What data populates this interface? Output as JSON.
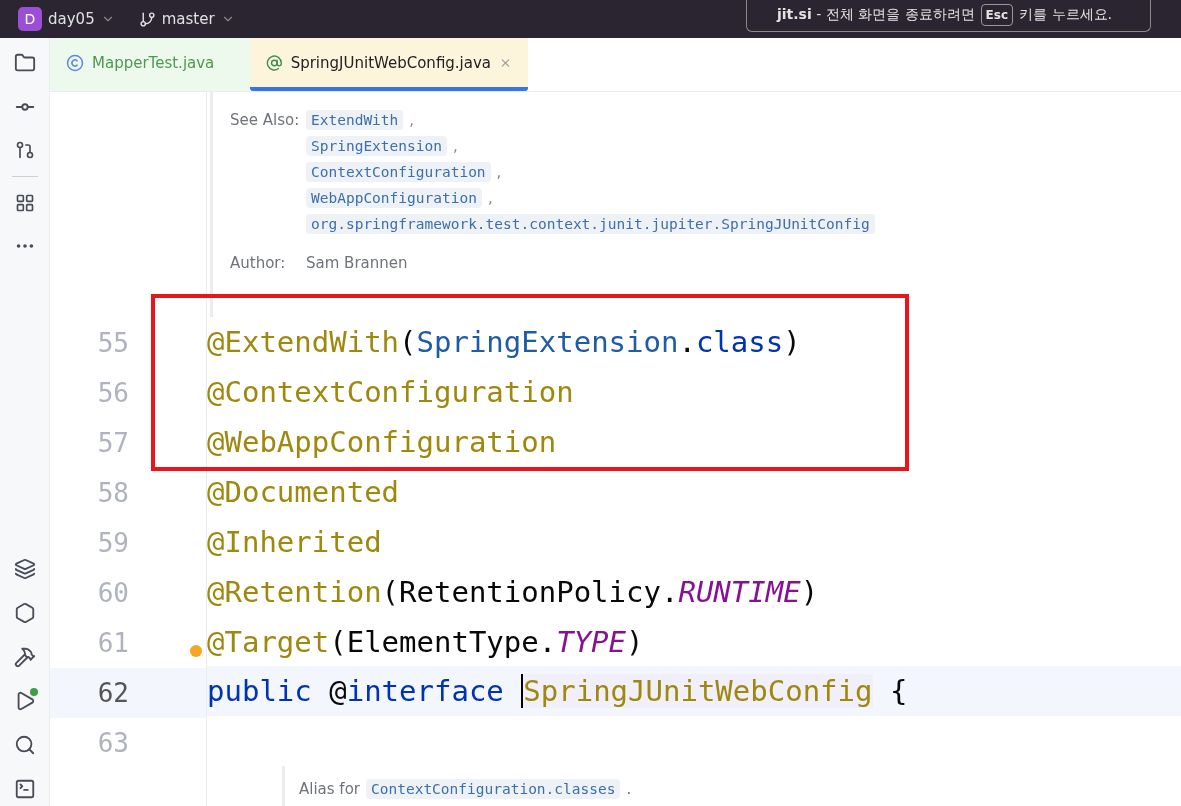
{
  "top_bar": {
    "project_initial": "D",
    "project": "day05",
    "branch": "master"
  },
  "notice": {
    "text": "**jit.si** - 전체 화면을 종료하려면",
    "key": "Esc",
    "after": "키를 누르세요."
  },
  "tabs": [
    {
      "label": "MapperTest.java",
      "kind": "class",
      "selected": false,
      "closable": false
    },
    {
      "label": "SpringJUnitWebConfig.java",
      "kind": "annotation",
      "selected": true,
      "closable": true
    }
  ],
  "doc_top": {
    "see_also_label": "See Also:",
    "see_also": [
      {
        "ref": "ExtendWith",
        "sep": ","
      },
      {
        "ref": "SpringExtension",
        "sep": ","
      },
      {
        "ref": "ContextConfiguration",
        "sep": ","
      },
      {
        "ref": "WebAppConfiguration",
        "sep": ","
      },
      {
        "ref": "org.springframework.test.context.junit.jupiter.SpringJUnitConfig"
      }
    ],
    "author_label": "Author:",
    "author": "Sam Brannen"
  },
  "code_lines": [
    {
      "number": "55",
      "boxed": true,
      "current": false,
      "bulb": false,
      "tokens": [
        {
          "kind": "ann",
          "text": "@ExtendWith"
        },
        {
          "kind": "plain",
          "text": "("
        },
        {
          "kind": "cls",
          "text": "SpringExtension"
        },
        {
          "kind": "plain",
          "text": "."
        },
        {
          "kind": "kw",
          "text": "class"
        },
        {
          "kind": "plain",
          "text": ")"
        }
      ]
    },
    {
      "number": "56",
      "boxed": true,
      "current": false,
      "bulb": false,
      "tokens": [
        {
          "kind": "ann",
          "text": "@ContextConfiguration"
        }
      ]
    },
    {
      "number": "57",
      "boxed": true,
      "current": false,
      "bulb": false,
      "tokens": [
        {
          "kind": "ann",
          "text": "@WebAppConfiguration"
        }
      ]
    },
    {
      "number": "58",
      "boxed": false,
      "current": false,
      "bulb": false,
      "tokens": [
        {
          "kind": "ann",
          "text": "@Documented"
        }
      ]
    },
    {
      "number": "59",
      "boxed": false,
      "current": false,
      "bulb": false,
      "tokens": [
        {
          "kind": "ann",
          "text": "@Inherited"
        }
      ]
    },
    {
      "number": "60",
      "boxed": false,
      "current": false,
      "bulb": false,
      "tokens": [
        {
          "kind": "ann",
          "text": "@Retention"
        },
        {
          "kind": "plain",
          "text": "(RetentionPolicy."
        },
        {
          "kind": "const",
          "text": "RUNTIME"
        },
        {
          "kind": "plain",
          "text": ")"
        }
      ]
    },
    {
      "number": "61",
      "boxed": false,
      "current": false,
      "bulb": true,
      "tokens": [
        {
          "kind": "ann",
          "text": "@Target"
        },
        {
          "kind": "plain",
          "text": "(ElementType."
        },
        {
          "kind": "const",
          "text": "TYPE"
        },
        {
          "kind": "plain",
          "text": ")"
        }
      ]
    },
    {
      "number": "62",
      "boxed": false,
      "current": true,
      "bulb": false,
      "tokens": [
        {
          "kind": "kw",
          "text": "public"
        },
        {
          "kind": "plain",
          "text": " @"
        },
        {
          "kind": "kw",
          "text": "interface "
        },
        {
          "kind": "decl",
          "text": "SpringJUnitWebConfig",
          "caret": true
        },
        {
          "kind": "plain",
          "text": " {"
        }
      ]
    },
    {
      "number": "63",
      "boxed": false,
      "current": false,
      "bulb": false
    }
  ],
  "doc_bottom": {
    "label": "Alias for",
    "ref": "ContextConfiguration.classes",
    "after": "."
  }
}
